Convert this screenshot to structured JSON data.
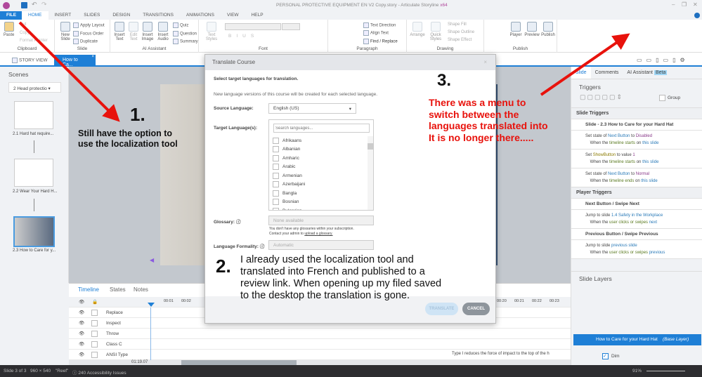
{
  "window": {
    "title": "PERSONAL PROTECTIVE EQUIPMENT EN V2 Copy.story - Articulate Storyline",
    "arch": "x64"
  },
  "ribbon_tabs": [
    "FILE",
    "HOME",
    "INSERT",
    "SLIDES",
    "DESIGN",
    "TRANSITIONS",
    "ANIMATIONS",
    "VIEW",
    "HELP"
  ],
  "ribbon": {
    "clipboard": {
      "label": "Clipboard",
      "paste": "Paste",
      "cut": "Cut",
      "copy": "Copy",
      "format_painter": "Format Painter"
    },
    "slide": {
      "label": "Slide",
      "new_slide": "New Slide",
      "apply_layout": "Apply Layout",
      "focus_order": "Focus Order",
      "duplicate": "Duplicate"
    },
    "ai": {
      "label": "AI Assistant",
      "insert_text": "Insert Text",
      "edit_text": "Edit Text",
      "insert_image": "Insert Image",
      "insert_audio": "Insert Audio",
      "quiz": "Quiz",
      "question": "Question",
      "summary": "Summary"
    },
    "font": {
      "label": "Font",
      "text_styles": "Text Styles"
    },
    "paragraph": {
      "label": "Paragraph",
      "text_direction": "Text Direction",
      "align_text": "Align Text",
      "find_replace": "Find / Replace"
    },
    "drawing": {
      "label": "Drawing",
      "arrange": "Arrange",
      "quick_styles": "Quick Styles",
      "shape_fill": "Shape Fill",
      "shape_outline": "Shape Outline",
      "shape_effect": "Shape Effect"
    },
    "publish": {
      "label": "Publish",
      "player": "Player",
      "preview": "Preview",
      "publish": "Publish"
    }
  },
  "doc_tabs": {
    "story_view": "STORY VIEW",
    "slide_tab": "How to Ca..."
  },
  "scenes": {
    "title": "Scenes",
    "selected_scene": "2 Head protectio",
    "slides": [
      "2.1 Hard hat require...",
      "2.2 Wear Your Hard H...",
      "2.3 How to Care for y..."
    ]
  },
  "dialog": {
    "title": "Translate Course",
    "intro": "Select target languages for translation.",
    "desc": "New language versions of this course will be created for each selected language.",
    "source_label": "Source Language:",
    "source_value": "English (US)",
    "target_label": "Target Language(s):",
    "search_placeholder": "Search languages...",
    "languages": [
      "Afrikaans",
      "Albanian",
      "Amharic",
      "Arabic",
      "Armenian",
      "Azerbaijani",
      "Bangla",
      "Bosnian",
      "Bulgarian"
    ],
    "glossary_label": "Glossary:",
    "glossary_value": "None available",
    "glossary_help": "You don't have any glossaries within your subscription.",
    "glossary_help2": "Contact your admin to",
    "glossary_link": "upload a glossary.",
    "formality_label": "Language Formality:",
    "formality_value": "Automatic",
    "translate": "TRANSLATE",
    "cancel": "CANCEL"
  },
  "right_panel": {
    "tabs": [
      "Slide",
      "Comments",
      "AI Assistant"
    ],
    "beta": "Beta",
    "triggers_title": "Triggers",
    "group": "Group",
    "slide_triggers": "Slide Triggers",
    "slide_name": "Slide - 2.3 How to Care for your Hard Hat",
    "player_triggers": "Player Triggers",
    "next": "Next Button / Swipe Next",
    "prev": "Previous Button / Swipe Previous",
    "slide_layers": "Slide Layers",
    "layer_name": "How to Care for your Hard Hat",
    "layer_tag": "(Base Layer)",
    "dim": "Dim"
  },
  "timeline": {
    "tabs": [
      "Timeline",
      "States",
      "Notes"
    ],
    "rows": [
      "Replace",
      "Inspect",
      "Throw",
      "Class C",
      "ANSI Type"
    ],
    "ticks_left": [
      "00:01",
      "00:02"
    ],
    "ticks_right": [
      "00:20",
      "00:21",
      "00:22",
      "00:23"
    ],
    "time": "01:19.07",
    "caption": "Type I reduces the force of impact to the top of the h"
  },
  "status": {
    "slide": "Slide 3 of 3",
    "size": "960 × 540",
    "theme": "\"Reef\"",
    "issues": "240 Accessibility Issues",
    "zoom": "91%"
  },
  "annotations": {
    "n1": "1.",
    "t1a": "Still have the option to",
    "t1b": "use the localization tool",
    "n2": "2.",
    "t2a": "I already used the localization tool and",
    "t2b": "translated into French and published to a",
    "t2c": "review link.  When opening up my filed saved",
    "t2d": "to the desktop the translation is gone.",
    "n3": "3.",
    "t3a": "There was a menu to",
    "t3b": "switch between the",
    "t3c": "languages translated into",
    "t3d": "It is no longer there.....",
    "color": "#e8120c"
  }
}
